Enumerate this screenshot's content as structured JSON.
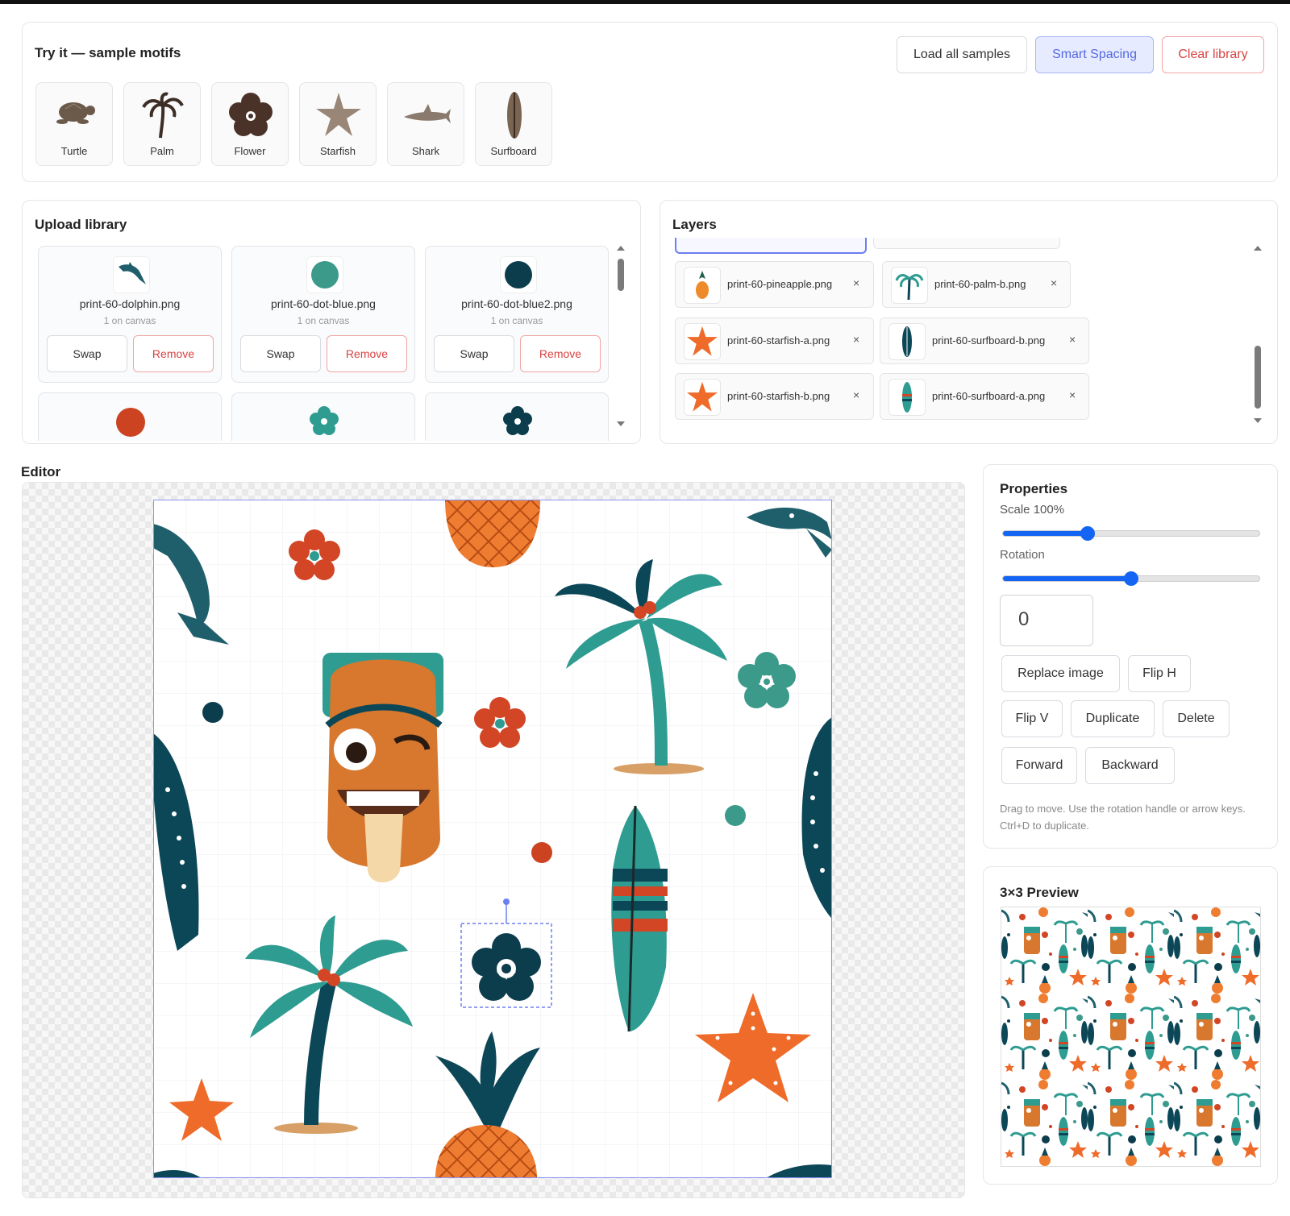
{
  "samples": {
    "title": "Try it — sample motifs",
    "load_all": "Load all samples",
    "smart_spacing": "Smart Spacing",
    "clear_library": "Clear library",
    "items": [
      {
        "label": "Turtle",
        "icon": "turtle-icon"
      },
      {
        "label": "Palm",
        "icon": "palm-icon"
      },
      {
        "label": "Flower",
        "icon": "flower-icon"
      },
      {
        "label": "Starfish",
        "icon": "starfish-icon"
      },
      {
        "label": "Shark",
        "icon": "shark-icon"
      },
      {
        "label": "Surfboard",
        "icon": "surfboard-icon"
      }
    ]
  },
  "library": {
    "title": "Upload library",
    "items": [
      {
        "name": "print-60-dolphin.png",
        "count": "1 on canvas",
        "swap": "Swap",
        "remove": "Remove"
      },
      {
        "name": "print-60-dot-blue.png",
        "count": "1 on canvas",
        "swap": "Swap",
        "remove": "Remove"
      },
      {
        "name": "print-60-dot-blue2.png",
        "count": "1 on canvas",
        "swap": "Swap",
        "remove": "Remove"
      }
    ]
  },
  "layers": {
    "title": "Layers",
    "items": [
      {
        "name": "print-60-pineapple.png",
        "remove": "×"
      },
      {
        "name": "print-60-palm-b.png",
        "remove": "×"
      },
      {
        "name": "print-60-starfish-a.png",
        "remove": "×"
      },
      {
        "name": "print-60-surfboard-b.png",
        "remove": "×"
      },
      {
        "name": "print-60-starfish-b.png",
        "remove": "×"
      },
      {
        "name": "print-60-surfboard-a.png",
        "remove": "×"
      }
    ]
  },
  "editor": {
    "title": "Editor"
  },
  "properties": {
    "title": "Properties",
    "scale_label": "Scale 100%",
    "scale_value": 0.33,
    "rotation_label": "Rotation",
    "rotation_value": 0.5,
    "rotation_input": "0",
    "replace": "Replace image",
    "flip_h": "Flip H",
    "flip_v": "Flip V",
    "duplicate": "Duplicate",
    "delete": "Delete",
    "forward": "Forward",
    "backward": "Backward",
    "hint": "Drag to move. Use the rotation handle or arrow keys. Ctrl+D to duplicate."
  },
  "preview": {
    "title": "3×3 Preview"
  },
  "colors": {
    "teal": "#2e9c91",
    "navy": "#0c4757",
    "orange": "#ef6b2a",
    "red": "#d24525",
    "accent": "#1565f5"
  }
}
